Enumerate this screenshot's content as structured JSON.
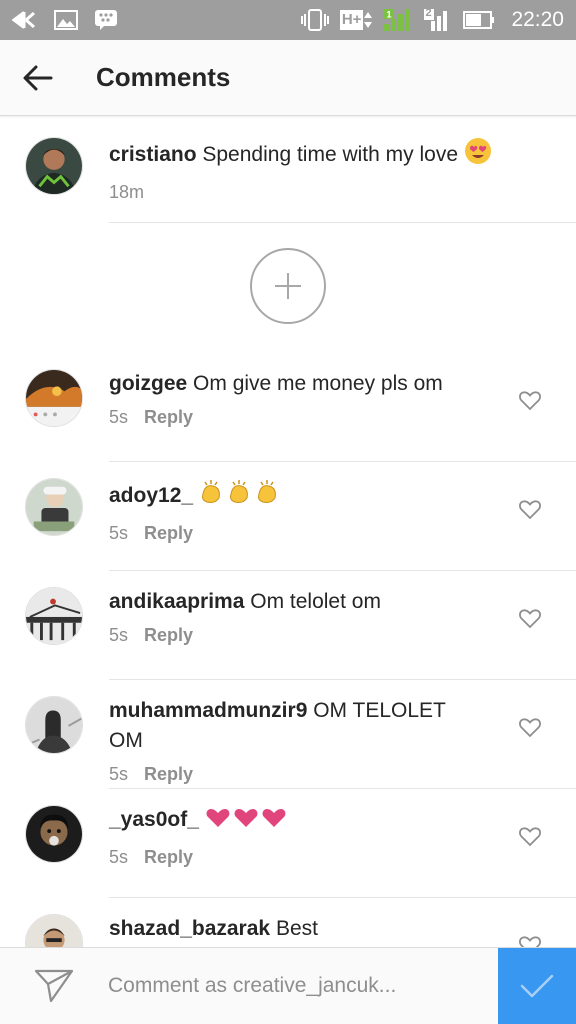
{
  "status_bar": {
    "time": "22:20",
    "network_type": "H+",
    "sim2_label": "2"
  },
  "header": {
    "title": "Comments"
  },
  "caption": {
    "username": "cristiano",
    "text": "Spending time with my love",
    "time": "18m"
  },
  "comments": [
    {
      "username": "goizgee",
      "text": "Om give me money pls om",
      "time": "5s",
      "reply": "Reply"
    },
    {
      "username": "adoy12_",
      "text": "",
      "emoji": "clapping-hands",
      "time": "5s",
      "reply": "Reply"
    },
    {
      "username": "andikaaprima",
      "text": "Om telolet om",
      "time": "5s",
      "reply": "Reply"
    },
    {
      "username": "muhammadmunzir9",
      "text": "OM TELOLET OM",
      "time": "5s",
      "reply": "Reply"
    },
    {
      "username": "_yas0of_",
      "text": "",
      "emoji": "hearts",
      "time": "5s",
      "reply": "Reply"
    },
    {
      "username": "shazad_bazarak",
      "text": "Best",
      "time": "",
      "reply": ""
    }
  ],
  "composer": {
    "placeholder": "Comment as creative_jancuk..."
  },
  "colors": {
    "accent": "#3897f0",
    "status_bar": "#9e9e9e",
    "heart_emoji": "#e0457b",
    "clap_emoji": "#f7c33a"
  }
}
